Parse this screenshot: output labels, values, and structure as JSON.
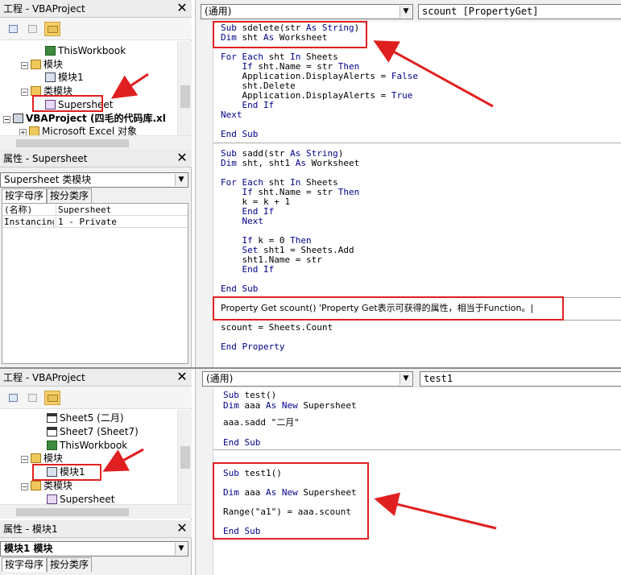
{
  "top": {
    "project_panel_title": "工程 - VBAProject",
    "tree": [
      {
        "label": "ThisWorkbook",
        "icon": "workbook-icon"
      },
      {
        "label": "模块",
        "icon": "folder-icon"
      },
      {
        "label": "模块1",
        "icon": "module-icon"
      },
      {
        "label": "类模块",
        "icon": "folder-icon"
      },
      {
        "label": "Supersheet",
        "icon": "class-module-icon"
      },
      {
        "label": "VBAProject (四毛的代码库.xl",
        "icon": "project-icon"
      },
      {
        "label": "Microsoft Excel 对象",
        "icon": "folder-icon"
      }
    ],
    "props_title": "属性 - Supersheet",
    "props_object": "Supersheet 类模块",
    "props_tabs": [
      "按字母序",
      "按分类序"
    ],
    "props_rows": [
      {
        "name": "(名称)",
        "value": "Supersheet"
      },
      {
        "name": "Instancing",
        "value": "1 - Private"
      }
    ],
    "object_combo": "(通用)",
    "proc_combo": "scount [PropertyGet]",
    "code": {
      "l1": "Sub sdelete(str As String)",
      "l2": "Dim sht As Worksheet",
      "l3": "For Each sht In Sheets",
      "l4": "    If sht.Name = str Then",
      "l5": "    Application.DisplayAlerts = False",
      "l6": "    sht.Delete",
      "l7": "    Application.DisplayAlerts = True",
      "l8": "    End If",
      "l9": "Next",
      "l10": "End Sub",
      "l11": "Sub sadd(str As String)",
      "l12": "Dim sht, sht1 As Worksheet",
      "l13": "For Each sht In Sheets",
      "l14": "    If sht.Name = str Then",
      "l15": "    k = k + 1",
      "l16": "    End If",
      "l17": "    Next",
      "l18": "    If k = 0 Then",
      "l19": "    Set sht1 = Sheets.Add",
      "l20": "    sht1.Name = str",
      "l21": "    End If",
      "l22": "End Sub",
      "l23": "Property Get scount() 'Property Get表示可获得的属性，相当于Function。|",
      "l24": "scount = Sheets.Count",
      "l25": "End Property"
    }
  },
  "bottom": {
    "project_panel_title": "工程 - VBAProject",
    "tree": [
      {
        "label": "Sheet5 (二月)",
        "icon": "sheet-icon"
      },
      {
        "label": "Sheet7 (Sheet7)",
        "icon": "sheet-icon"
      },
      {
        "label": "ThisWorkbook",
        "icon": "workbook-icon"
      },
      {
        "label": "模块",
        "icon": "folder-icon"
      },
      {
        "label": "模块1",
        "icon": "module-icon"
      },
      {
        "label": "类模块",
        "icon": "folder-icon"
      },
      {
        "label": "Supersheet",
        "icon": "class-module-icon"
      }
    ],
    "props_title": "属性 - 模块1",
    "props_object": "模块1 模块",
    "props_tabs": [
      "按字母序",
      "按分类序"
    ],
    "object_combo": "(通用)",
    "proc_combo": "test1",
    "code": {
      "l1": "Sub test()",
      "l2": "Dim aaa As New Supersheet",
      "l3": "aaa.sadd \"二月\"",
      "l4": "End Sub",
      "l5": "Sub test1()",
      "l6": "Dim aaa As New Supersheet",
      "l7": "Range(\"a1\") = aaa.scount",
      "l8": "End Sub"
    }
  },
  "colors": {
    "highlight_box": "#e02020",
    "arrow": "#e02020",
    "keyword": "#00008b"
  }
}
